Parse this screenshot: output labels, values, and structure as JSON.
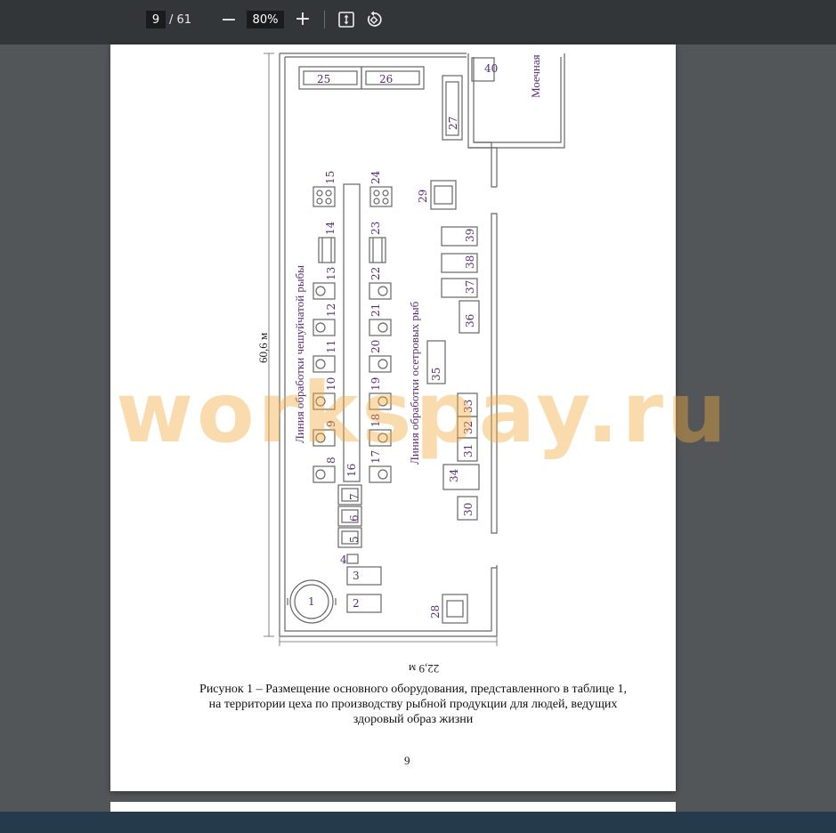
{
  "toolbar": {
    "current_page": "9",
    "total_pages": "/ 61",
    "zoom": "80%",
    "zoom_out_icon": "minus-icon",
    "zoom_in_icon": "plus-icon",
    "fit_icon": "fit-page-icon",
    "rotate_icon": "rotate-icon"
  },
  "figure": {
    "dimension_height": "60,6 м",
    "dimension_width": "22,9 м",
    "room_label": "Моечная",
    "line1_label": "Линия обработки чешуйчатой рыбы",
    "line2_label": "Линия обработки осетровых рыб",
    "equipment": [
      "1",
      "2",
      "3",
      "4",
      "5",
      "6",
      "7",
      "8",
      "9",
      "10",
      "11",
      "12",
      "13",
      "14",
      "15",
      "16",
      "17",
      "18",
      "19",
      "20",
      "21",
      "22",
      "23",
      "24",
      "25",
      "26",
      "27",
      "28",
      "29",
      "30",
      "31",
      "32",
      "33",
      "34",
      "35",
      "36",
      "37",
      "38",
      "39",
      "40"
    ]
  },
  "caption": "Рисунок 1 – Размещение основного оборудования, представленного в таблице 1, на территории цеха по производству рыбной продукции для людей, ведущих здоровый образ жизни",
  "page_number": "9",
  "watermark": "workspay.ru",
  "colors": {
    "toolbar_bg": "#323639",
    "viewer_bg": "#525659",
    "label_color": "#5a2a7a",
    "wall_color": "#666666"
  }
}
